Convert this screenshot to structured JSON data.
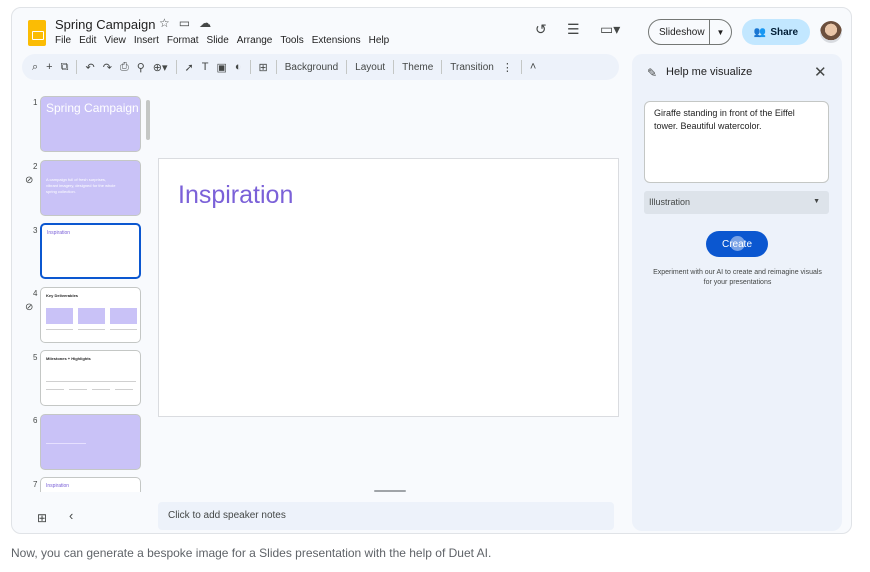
{
  "document": {
    "title": "Spring Campaign"
  },
  "menu": [
    "File",
    "Edit",
    "View",
    "Insert",
    "Format",
    "Slide",
    "Arrange",
    "Tools",
    "Extensions",
    "Help"
  ],
  "header": {
    "slideshow_label": "Slideshow",
    "share_label": "Share"
  },
  "toolbar": {
    "background_label": "Background",
    "layout_label": "Layout",
    "theme_label": "Theme",
    "transition_label": "Transition"
  },
  "slides": [
    {
      "number": "1",
      "title": "Spring Campaign"
    },
    {
      "number": "2",
      "title": "A campaign full of fresh surprises, vibrant imagery, designed for the whole spring collection."
    },
    {
      "number": "3",
      "title": "Inspiration"
    },
    {
      "number": "4",
      "title": "Key Deliverables"
    },
    {
      "number": "5",
      "title": "Milestones + Highlights"
    },
    {
      "number": "6",
      "title": ""
    },
    {
      "number": "7",
      "title": "Inspiration"
    }
  ],
  "canvas": {
    "slide_title": "Inspiration"
  },
  "notes": {
    "placeholder": "Click to add speaker notes"
  },
  "panel": {
    "title": "Help me visualize",
    "prompt": "Giraffe standing in front of the Eiffel tower. Beautiful watercolor.",
    "style_value": "Illustration",
    "create_label": "Create",
    "hint": "Experiment with our AI to create and reimagine visuals for your presentations"
  },
  "caption": "Now, you can generate a bespoke image for a Slides presentation with the help of Duet AI.",
  "colors": {
    "accent_blue": "#0b57d0",
    "share_blue": "#c2e7ff",
    "slide_purple": "#7b61d8",
    "thumb_purple": "#c9c2f7",
    "logo_yellow": "#fbbc04"
  },
  "icons": [
    "star-icon",
    "folder-move-icon",
    "cloud-saved-icon",
    "history-icon",
    "comments-icon",
    "meet-icon",
    "people-icon",
    "search-icon",
    "add-icon",
    "redo-icon",
    "undo-icon",
    "print-icon",
    "paint-format-icon",
    "zoom-icon",
    "select-icon",
    "textbox-icon",
    "image-icon",
    "shape-icon",
    "comment-add-icon",
    "more-icon",
    "collapse-icon",
    "link-icon",
    "magic-wand-icon",
    "close-icon",
    "grid-view-icon",
    "chevron-left-icon"
  ]
}
